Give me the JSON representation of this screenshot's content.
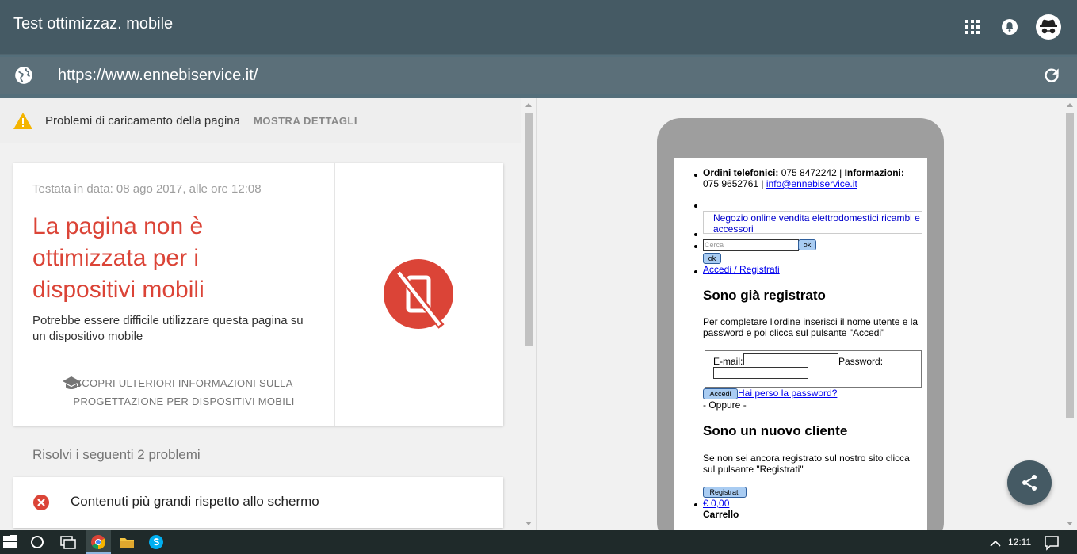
{
  "header": {
    "title": "Test ottimizzaz. mobile"
  },
  "urlbar": {
    "url": "https://www.ennebiservice.it/"
  },
  "warning": {
    "message": "Problemi di caricamento della pagina",
    "details_label": "MOSTRA DETTAGLI"
  },
  "result": {
    "date": "Testata in data: 08 ago 2017, alle ore 12:08",
    "headline": "La pagina non è ottimizzata per i dispositivi mobili",
    "description": "Potrebbe essere difficile utilizzare questa pagina su un dispositivo mobile",
    "learn_more": "SCOPRI ULTERIORI INFORMAZIONI SULLA PROGETTAZIONE PER DISPOSITIVI MOBILI"
  },
  "problems": {
    "heading": "Risolvi i seguenti 2 problemi",
    "items": [
      {
        "label": "Contenuti più grandi rispetto allo schermo"
      }
    ]
  },
  "preview": {
    "orders_label": "Ordini telefonici:",
    "orders_phone": "075 8472242 |",
    "info_label": "Informazioni:",
    "info_phone": "075 9652761 |",
    "email": "info@ennebiservice.it",
    "shop_link": "Negozio online vendita elettrodomestici ricambi e accessori",
    "search_placeholder": "Cerca",
    "ok_label": "ok",
    "login_link": "Accedi / Registrati",
    "registered_title": "Sono già registrato",
    "registered_desc": "Per completare l'ordine inserisci il nome utente e la password e poi clicca sul pulsante \"Accedi\"",
    "email_label": "E-mail:",
    "password_label": "Password:",
    "login_btn": "Accedi",
    "forgot_link": "Hai perso la password?",
    "or_label": "- Oppure -",
    "new_title": "Sono un nuovo cliente",
    "new_desc": "Se non sei ancora registrato sul nostro sito clicca sul pulsante \"Registrati\"",
    "register_btn": "Registrati",
    "cart_total": "€ 0,00",
    "cart_label": "Carrello"
  },
  "taskbar": {
    "time": "12:11"
  },
  "colors": {
    "header_bg": "#455a64",
    "error_red": "#db4437",
    "warning_yellow": "#f4b400"
  }
}
